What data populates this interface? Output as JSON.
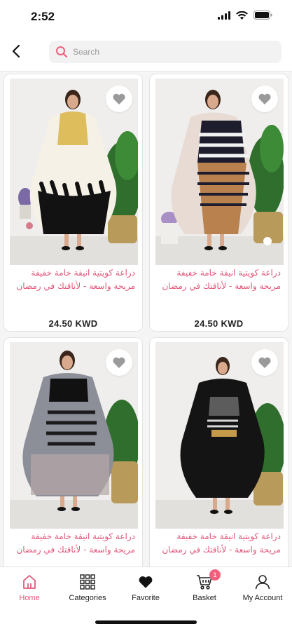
{
  "status_bar": {
    "time": "2:52"
  },
  "header": {
    "search_placeholder": "Search"
  },
  "products": [
    {
      "title": "دراعة كويتية انيقة خامة خفيفة مريحة واسعة - لأناقتك في رمضان",
      "price": "24.50 KWD"
    },
    {
      "title": "دراعة كويتية انيقة خامة خفيفة مريحة واسعة - لأناقتك في رمضان",
      "price": "24.50 KWD"
    },
    {
      "title": "دراعة كويتية انيقة خامة خفيفة مريحة واسعة - لأناقتك في رمضان",
      "price": ""
    },
    {
      "title": "دراعة كويتية انيقة خامة خفيفة مريحة واسعة - لأناقتك في رمضان",
      "price": ""
    }
  ],
  "tabbar": {
    "items": [
      {
        "label": "Home",
        "icon": "home-icon",
        "active": true
      },
      {
        "label": "Categories",
        "icon": "grid-icon"
      },
      {
        "label": "Favorite",
        "icon": "heart-icon"
      },
      {
        "label": "Basket",
        "icon": "cart-icon",
        "badge": "1"
      },
      {
        "label": "My Account",
        "icon": "user-icon"
      }
    ]
  },
  "colors": {
    "accent": "#e3577a",
    "badge": "#f0607d"
  }
}
